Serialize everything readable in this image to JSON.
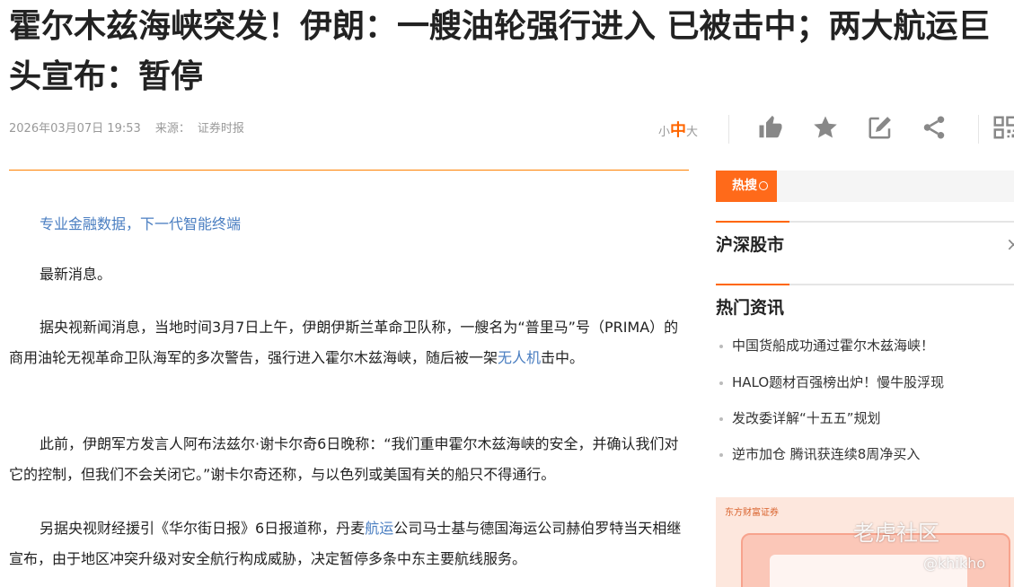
{
  "article": {
    "title": "霍尔木兹海峡突发！伊朗：一艘油轮强行进入 已被击中；两大航运巨头宣布：暂停",
    "date": "2026年03月07日 19:53",
    "source_label": "来源：",
    "source": "证券时报",
    "promo": "专业金融数据，下一代智能终端",
    "p1": "最新消息。",
    "p2_a": "据央视新闻消息，当地时间3月7日上午，伊朗伊斯兰革命卫队称，一艘名为“普里马”号（PRIMA）的商用油轮无视革命卫队海军的多次警告，强行进入霍尔木兹海峡，随后被一架",
    "p2_link": "无人机",
    "p2_b": "击中。",
    "p3": "此前，伊朗军方发言人阿布法兹尔·谢卡尔奇6日晚称：“我们重申霍尔木兹海峡的安全，并确认我们对它的控制，但我们不会关闭它。”谢卡尔奇还称，与以色列或美国有关的船只不得通行。",
    "p4_a": "另据央视财经援引《华尔街日报》6日报道称，丹麦",
    "p4_link": "航运",
    "p4_b": "公司马士基与德国海运公司赫伯罗特当天相继宣布，由于地区冲突升级对安全航行构成威胁，决定暂停多条中东主要航线服务。"
  },
  "font_size": {
    "small": "小",
    "medium": "中",
    "large": "大"
  },
  "toolbar": {
    "icons": [
      "thumbs-up-icon",
      "star-icon",
      "edit-icon",
      "share-icon",
      "qrcode-icon"
    ]
  },
  "sidebar": {
    "hot_label": "热搜",
    "section1": "沪深股市",
    "section2": "热门资讯",
    "close_glyph": "×",
    "news": [
      "中国货船成功通过霍尔木兹海峡！",
      "HALO题材百强榜出炉！慢牛股浮现",
      "发改委详解“十五五”规划",
      "逆市加仓 腾讯获连续8周净买入"
    ],
    "ad_brand": "东方财富证券"
  },
  "watermark": {
    "main": "老虎社区",
    "sub": "@khikho"
  },
  "colors": {
    "accent": "#ff6600",
    "link": "#4a7ec1"
  }
}
